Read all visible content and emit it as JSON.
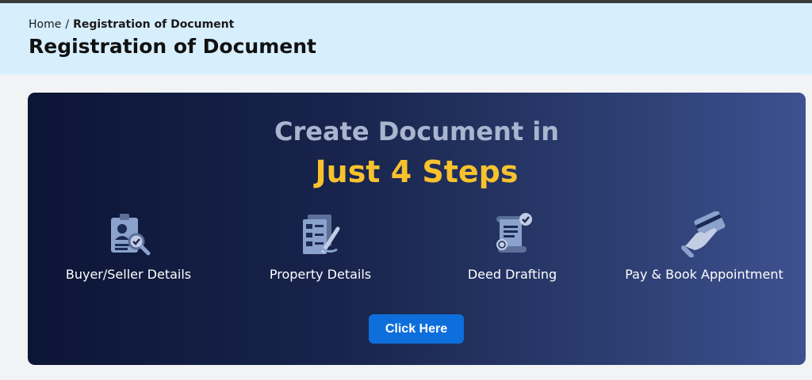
{
  "breadcrumb": {
    "home": "Home",
    "separator": "/",
    "current": "Registration of Document"
  },
  "page_title": "Registration of Document",
  "banner": {
    "headline": "Create Document in",
    "subheadline": "Just 4 Steps",
    "steps": [
      {
        "label": "Buyer/Seller Details",
        "icon": "id-card-search-icon"
      },
      {
        "label": "Property Details",
        "icon": "documents-pen-icon"
      },
      {
        "label": "Deed Drafting",
        "icon": "scroll-fingerprint-icon"
      },
      {
        "label": "Pay & Book Appointment",
        "icon": "hand-card-icon"
      }
    ],
    "cta_label": "Click Here"
  },
  "colors": {
    "header_bg": "#d7effd",
    "banner_start": "#0c1536",
    "banner_end": "#3e5190",
    "headline": "#a9b5cf",
    "accent": "#f7c22e",
    "button": "#0e6fdc",
    "icon": "#8aa2cc"
  }
}
